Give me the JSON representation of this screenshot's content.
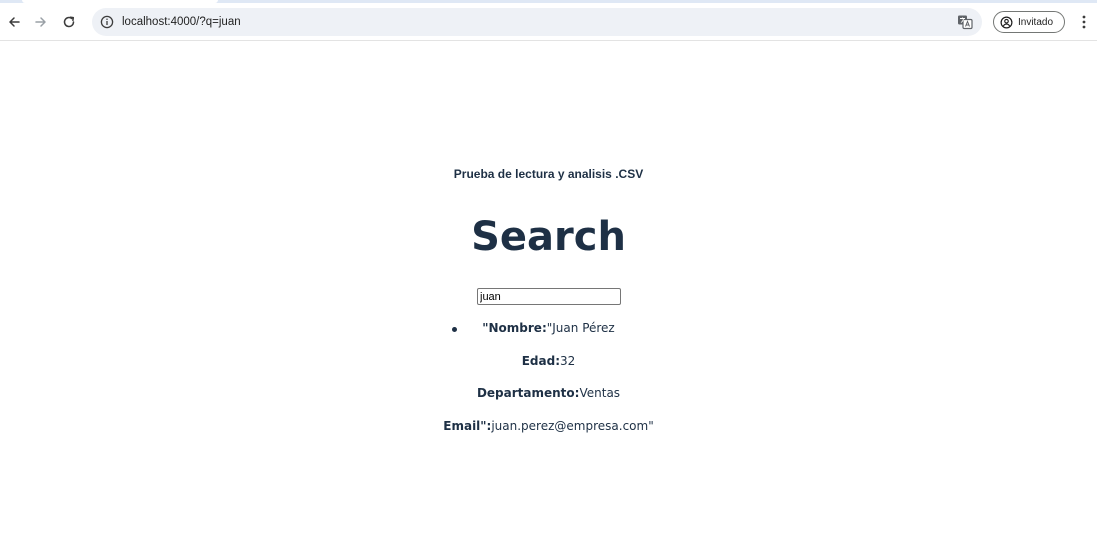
{
  "browser": {
    "url": "localhost:4000/?q=juan",
    "profile_label": "Invitado"
  },
  "page": {
    "subtitle": "Prueba de lectura y analisis .CSV",
    "title": "Search",
    "search_value": "juan"
  },
  "results": [
    {
      "nombre_key": "\"Nombre:",
      "nombre_value": "\"Juan Pérez",
      "edad_key": "Edad:",
      "edad_value": "32",
      "departamento_key": "Departamento:",
      "departamento_value": "Ventas",
      "email_key": "Email\":",
      "email_value": "juan.perez@empresa.com\""
    }
  ],
  "colors": {
    "text": "#1e3045",
    "omnibox_bg": "#eef1f6"
  },
  "icons": {
    "back": "back-arrow-icon",
    "forward": "forward-arrow-icon",
    "reload": "reload-icon",
    "info": "info-icon",
    "translate": "translate-icon",
    "profile": "profile-icon",
    "menu": "kebab-menu-icon"
  }
}
